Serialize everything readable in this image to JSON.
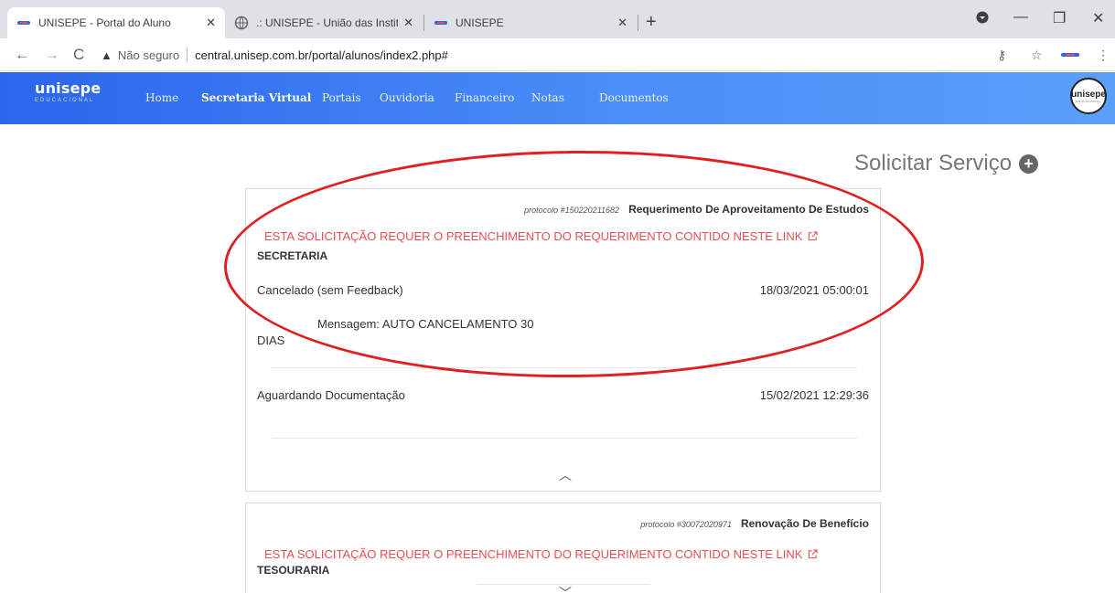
{
  "browser": {
    "tabs": [
      {
        "title": "UNISEPE - Portal do Aluno",
        "active": true
      },
      {
        "title": ".: UNISEPE - União das Instituiçõ",
        "active": false
      },
      {
        "title": "UNISEPE",
        "active": false
      }
    ],
    "address": {
      "security_label": "Não seguro",
      "url": "central.unisep.com.br/portal/alunos/index2.php#"
    }
  },
  "site": {
    "brand_name": "unisepe",
    "brand_sub": "EDUCACIONAL",
    "nav": [
      "Home",
      "Secretaria Virtual",
      "Portais",
      "Ouvidoria",
      "Financeiro",
      "Notas",
      "Documentos"
    ],
    "active_nav": "Secretaria Virtual",
    "logo_text": "unisepe",
    "logo_sub": "EDUCACIONAL"
  },
  "page": {
    "solicitar_label": "Solicitar Serviço",
    "requests": [
      {
        "protocol": "protocolo #150220211682",
        "service": "Requerimento De Aproveitamento De Estudos",
        "link_text": "ESTA SOLICITAÇÃO REQUER O PREENCHIMENTO DO REQUERIMENTO CONTIDO NESTE LINK",
        "department": "SECRETARIA",
        "history": [
          {
            "status": "Cancelado (sem Feedback)",
            "date": "18/03/2021 05:00:01",
            "message_a": "Mensagem: AUTO CANCELAMENTO 30",
            "message_b": "DIAS"
          },
          {
            "status": "Aguardando Documentação",
            "date": "15/02/2021 12:29:36"
          }
        ]
      },
      {
        "protocol": "protocolo #30072020971",
        "service": "Renovação De Benefício",
        "link_text": "ESTA SOLICITAÇÃO REQUER O PREENCHIMENTO DO REQUERIMENTO CONTIDO NESTE LINK",
        "department": "TESOURARIA"
      }
    ]
  },
  "colors": {
    "nav_gradient_start": "#2b65ec",
    "nav_gradient_end": "#5aa0f8",
    "link_red": "#e35050",
    "annotation_red": "#e02020"
  }
}
